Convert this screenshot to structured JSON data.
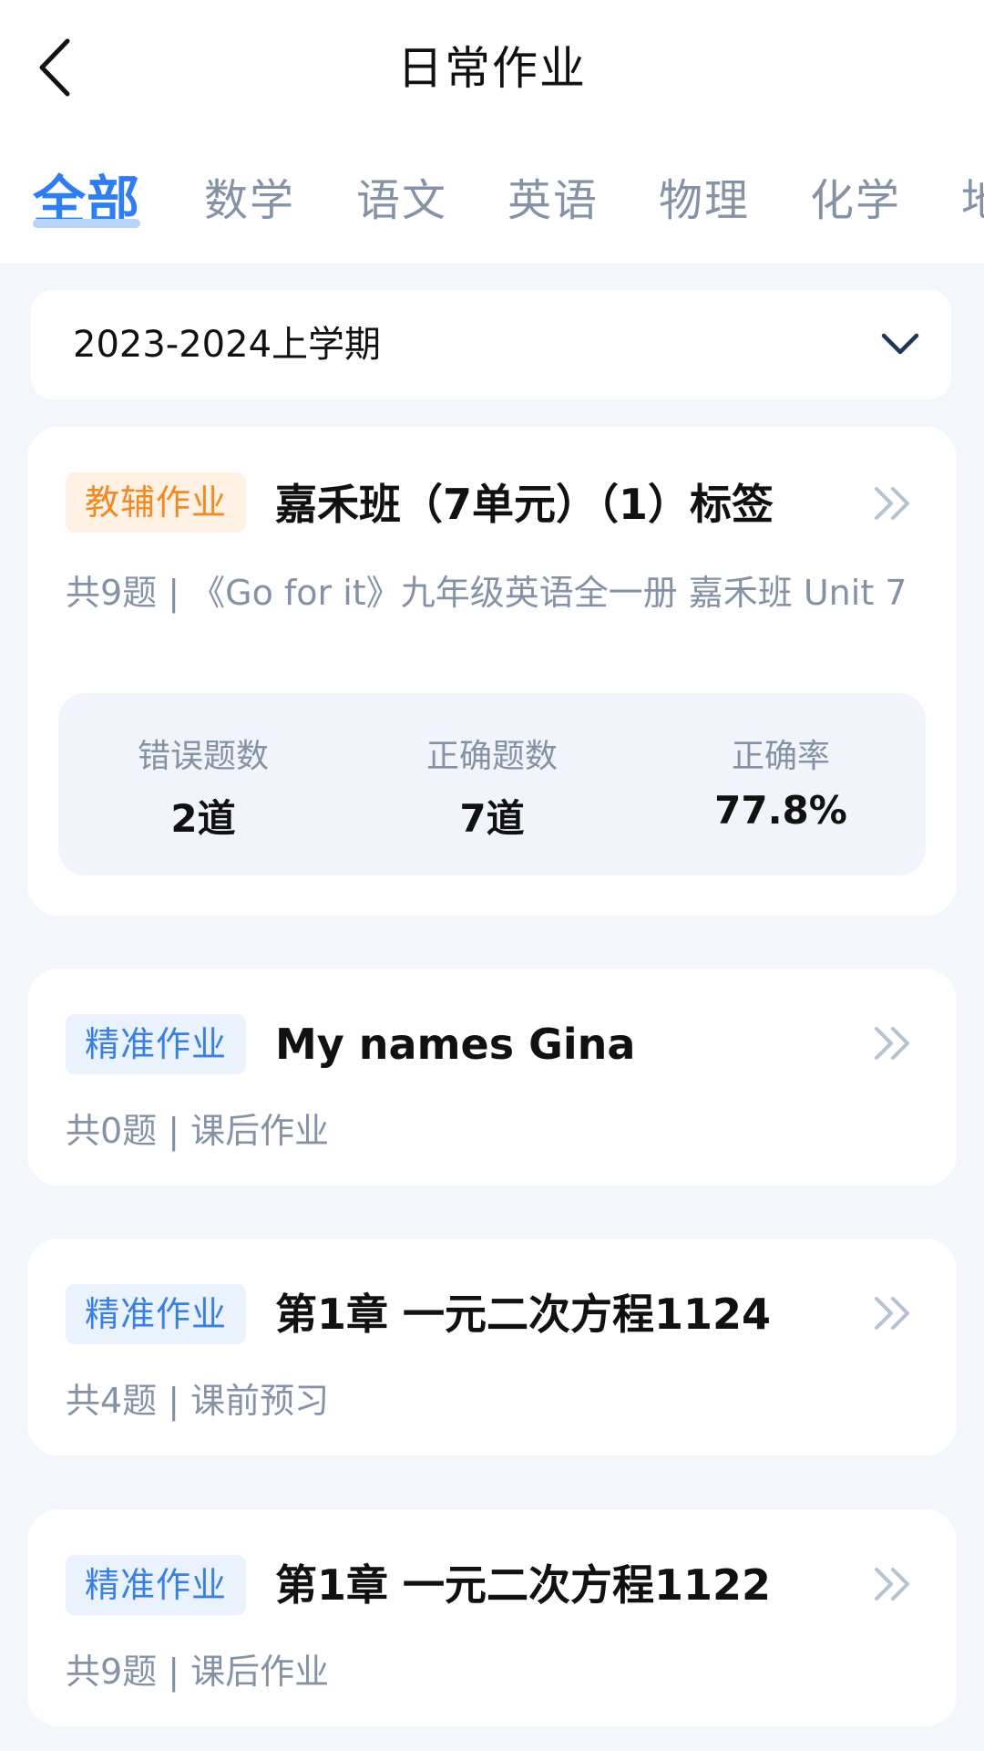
{
  "header": {
    "title": "日常作业",
    "back_icon": "back-arrow-icon"
  },
  "tabs": [
    {
      "label": "全部",
      "active": true
    },
    {
      "label": "数学",
      "active": false
    },
    {
      "label": "语文",
      "active": false
    },
    {
      "label": "英语",
      "active": false
    },
    {
      "label": "物理",
      "active": false
    },
    {
      "label": "化学",
      "active": false
    },
    {
      "label": "地",
      "active": false
    }
  ],
  "semester": {
    "value": "2023-2024上学期",
    "icon": "chevron-down-icon"
  },
  "colors": {
    "accent": "#2f7df2",
    "tag_orange_bg": "#fff1e4",
    "tag_orange_text": "#f08a24",
    "tag_blue_bg": "#e9f2fd",
    "tag_blue_text": "#3a80e0",
    "muted_text": "#8592a6",
    "page_bg": "#f3f6fb"
  },
  "assignments": [
    {
      "tag": "教辅作业",
      "title": "嘉禾班（7单元）（1）标签",
      "meta": "共9题 | 《Go for it》九年级英语全一册 嘉禾班 Unit 7",
      "stats": [
        {
          "label": "错误题数",
          "value": "2道"
        },
        {
          "label": "正确题数",
          "value": "7道"
        },
        {
          "label": "正确率",
          "value": "77.8%"
        }
      ]
    },
    {
      "tag": "精准作业",
      "title": "My names Gina",
      "meta": "共0题 | 课后作业"
    },
    {
      "tag": "精准作业",
      "title": "第1章 一元二次方程1124",
      "meta": "共4题 | 课前预习"
    },
    {
      "tag": "精准作业",
      "title": "第1章 一元二次方程1122",
      "meta": "共9题 | 课后作业"
    }
  ]
}
